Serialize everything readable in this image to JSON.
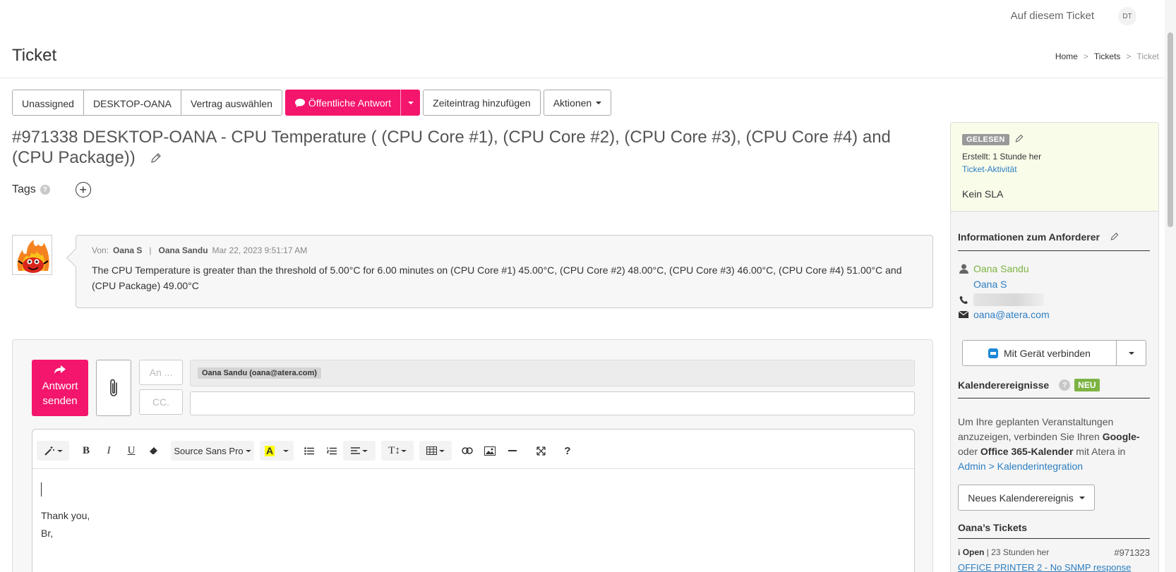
{
  "header": {
    "ticket_link": "Auf diesem Ticket",
    "avatar_initials": "DT",
    "page_title": "Ticket",
    "breadcrumbs": [
      "Home",
      "Tickets",
      "Ticket"
    ],
    "breadcrumb_sep": ">"
  },
  "toolbar": {
    "unassigned": "Unassigned",
    "device": "DESKTOP-OANA",
    "contract": "Vertrag auswählen",
    "public_reply": "Öffentliche Antwort",
    "time_entry": "Zeiteintrag hinzufügen",
    "actions": "Aktionen",
    "accent_color": "#f4156c"
  },
  "ticket": {
    "title": "#971338 DESKTOP-OANA - CPU Temperature ( (CPU Core #1), (CPU Core #2), (CPU Core #3), (CPU Core #4) and (CPU Package))",
    "tags_label": "Tags",
    "help_glyph": "?",
    "add_glyph": "+"
  },
  "message": {
    "from_label": "Von:",
    "from_short": "Oana S",
    "separator": "|",
    "from_full": "Oana Sandu",
    "timestamp": "Mar 22, 2023 9:51:17 AM",
    "body": "The CPU Temperature is greater than the threshold of 5.00°C for 6.00 minutes on (CPU Core #1) 45.00°C, (CPU Core #2) 48.00°C, (CPU Core #3) 46.00°C, (CPU Core #4) 51.00°C and (CPU Package) 49.00°C"
  },
  "reply": {
    "send_line1": "Antwort",
    "send_line2": "senden",
    "to_placeholder": "An ...",
    "cc_placeholder": "CC.",
    "recipient_chip": "Oana Sandu (oana@atera.com)",
    "font_name": "Source Sans Pro",
    "help_glyph": "?",
    "body_line1": "Thank you,",
    "body_line2": "Br,"
  },
  "sidebar": {
    "status_badge": "GELESEN",
    "created": "Erstellt: 1 Stunde her",
    "activity_link": "Ticket-Aktivität",
    "sla": "Kein SLA",
    "requester_title": "Informationen zum Anforderer",
    "requester_name": "Oana Sandu",
    "requester_short": "Oana S",
    "requester_email": "oana@atera.com",
    "connect_button": "Mit Gerät verbinden",
    "calendar_title": "Kalenderereignisse",
    "calendar_help": "?",
    "new_badge": "NEU",
    "calendar_text_1": "Um Ihre geplanten Veranstaltungen anzuzeigen, verbinden Sie Ihren ",
    "calendar_google": "Google-",
    "calendar_text_2": " oder ",
    "calendar_office": "Office 365-Kalender",
    "calendar_text_3": " mit Atera in ",
    "calendar_link": "Admin > Kalenderintegration",
    "new_event_button": "Neues Kalenderereignis",
    "tickets_title": "Oana’s Tickets",
    "ticket_status": "Open",
    "ticket_age": "| 23 Stunden her",
    "ticket_id": "#971323",
    "ticket_link": "OFFICE PRINTER 2 - No SNMP response"
  }
}
